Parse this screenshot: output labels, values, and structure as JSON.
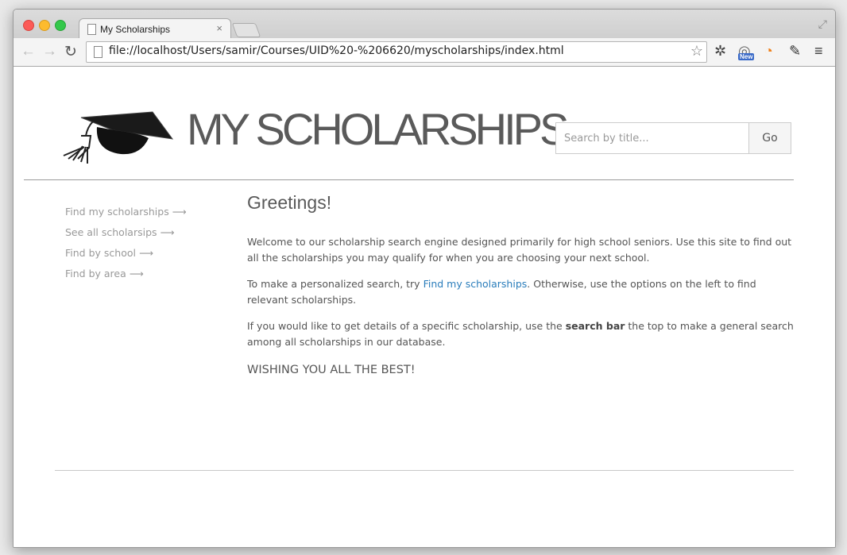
{
  "browser": {
    "tab_title": "My Scholarships",
    "tab_close": "×",
    "url": "file://localhost/Users/samir/Courses/UID%20-%206620/myscholarships/index.html"
  },
  "header": {
    "site_title": "MY SCHOLARSHIPS",
    "search_placeholder": "Search by title...",
    "go_label": "Go"
  },
  "sidebar": {
    "links": [
      {
        "label": "Find my scholarships ⟶"
      },
      {
        "label": "See all scholarsips ⟶"
      },
      {
        "label": "Find by school ⟶"
      },
      {
        "label": "Find by area ⟶"
      }
    ]
  },
  "main": {
    "heading": "Greetings!",
    "p1": "Welcome to our scholarship search engine designed primarily for high school seniors. Use this site to find out all the scholarships you may qualify for when you are choosing your next school.",
    "p2_before": "To make a personalized search, try ",
    "p2_link": "Find my scholarships",
    "p2_after": ". Otherwise, use the options on the left to find relevant scholarships.",
    "p3_before": "If you would like to get details of a specific scholarship, use the ",
    "p3_bold": "search bar",
    "p3_after": " the top to make a general search among all scholarships in our database.",
    "closing": "WISHING YOU ALL THE BEST!"
  },
  "colors": {
    "link": "#2a7dbb",
    "sidebar_link": "#999999",
    "title": "#5a5a5a"
  }
}
